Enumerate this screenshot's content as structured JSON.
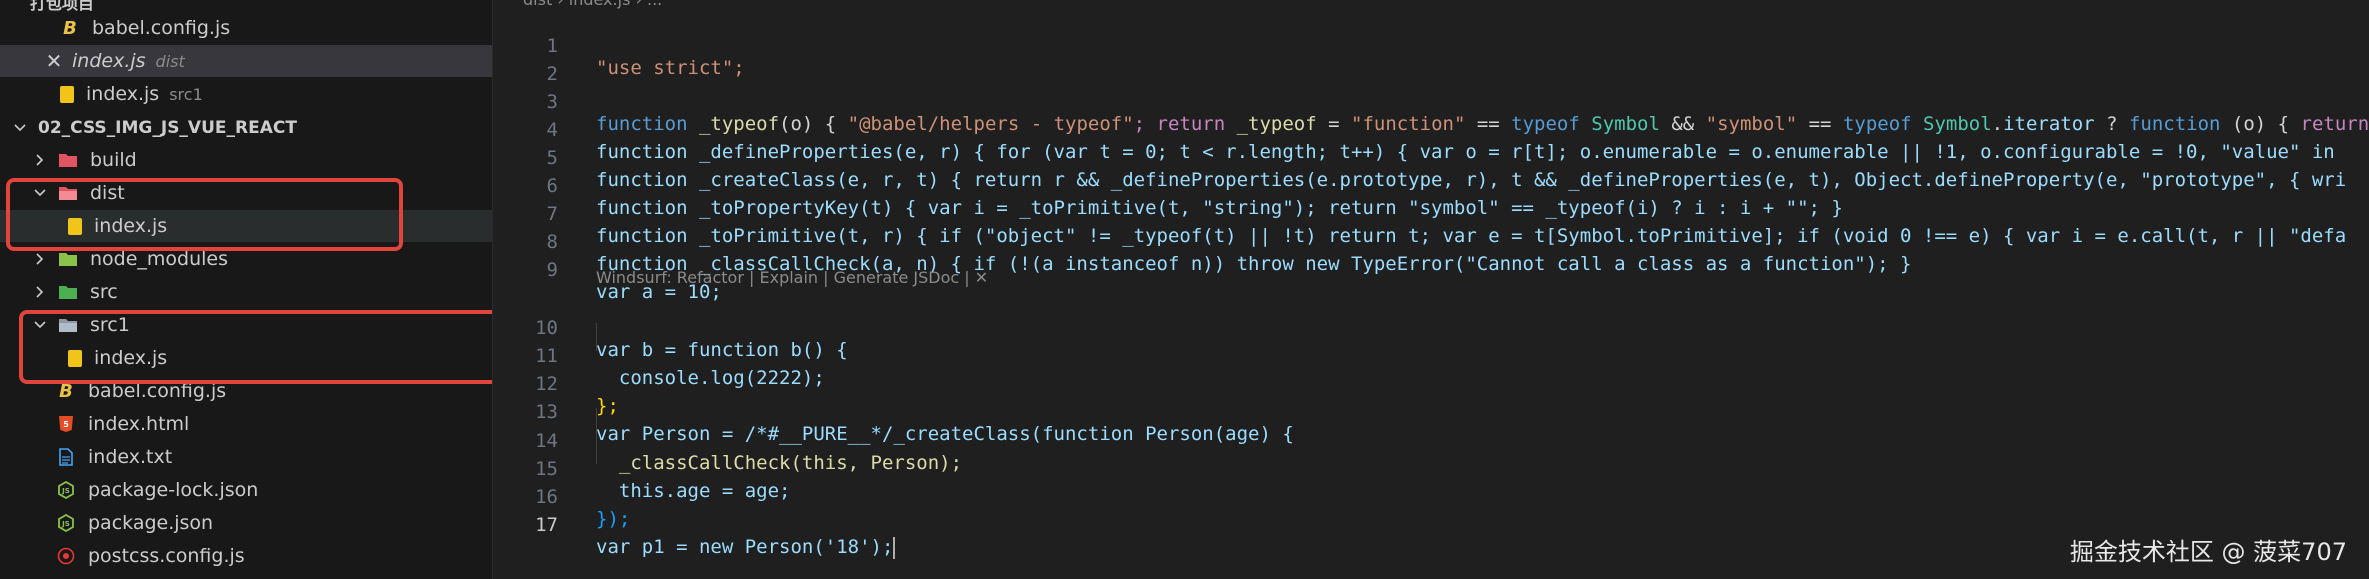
{
  "explorer": {
    "top_folder_partial": "打包项目",
    "items": [
      {
        "label": "babel.config.js",
        "icon": "babel-icon"
      },
      {
        "label": "index.js",
        "desc": "dist",
        "icon": "close-icon"
      },
      {
        "label": "index.js",
        "desc": "src1",
        "icon": "js-file-icon"
      }
    ],
    "section_title": "02_CSS_IMG_JS_VUE_REACT",
    "tree": [
      {
        "label": "build",
        "type": "folder"
      },
      {
        "label": "dist",
        "type": "folder-open"
      },
      {
        "label": "index.js",
        "type": "js"
      },
      {
        "label": "node_modules",
        "type": "folder"
      },
      {
        "label": "src",
        "type": "folder"
      },
      {
        "label": "src1",
        "type": "folder-open"
      },
      {
        "label": "index.js",
        "type": "js"
      },
      {
        "label": "babel.config.js",
        "type": "babel"
      },
      {
        "label": "index.html",
        "type": "html"
      },
      {
        "label": "index.txt",
        "type": "txt"
      },
      {
        "label": "package-lock.json",
        "type": "json"
      },
      {
        "label": "package.json",
        "type": "json"
      },
      {
        "label": "postcss.config.js",
        "type": "postcss"
      }
    ]
  },
  "editor": {
    "breadcrumb": "dist › index.js › ...",
    "codelens": "Windsurf: Refactor | Explain | Generate JSDoc | ✕",
    "line_numbers": [
      "1",
      "2",
      "3",
      "4",
      "5",
      "6",
      "7",
      "8",
      "9",
      "10",
      "11",
      "12",
      "13",
      "14",
      "15",
      "16",
      "17"
    ],
    "active_line": "17",
    "code": {
      "l1": "\"use strict\";",
      "l3a": "function ",
      "l3b": "_typeof",
      "l3c": "(o) { ",
      "l3d": "\"@babel/helpers - typeof\"",
      "l3e": "; return ",
      "l3f": "_typeof",
      "l3g": " = ",
      "l3h": "\"function\"",
      "l3i": " == ",
      "l3j": "typeof ",
      "l3k": "Symbol",
      "l3l": " && ",
      "l3m": "\"symbol\"",
      "l3n": " == ",
      "l3o": "typeof ",
      "l3p": "Symbol",
      "l3q": ".",
      "l3r": "iterator",
      "l3s": " ? ",
      "l3t": "function ",
      "l3u": "(o) { ",
      "l3v": "return",
      "l4": "function _defineProperties(e, r) { for (var t = 0; t < r.length; t++) { var o = r[t]; o.enumerable = o.enumerable || !1, o.configurable = !0, \"value\" in",
      "l5": "function _createClass(e, r, t) { return r && _defineProperties(e.prototype, r), t && _defineProperties(e, t), Object.defineProperty(e, \"prototype\", { wri",
      "l6": "function _toPropertyKey(t) { var i = _toPrimitive(t, \"string\"); return \"symbol\" == _typeof(i) ? i : i + \"\"; }",
      "l7": "function _toPrimitive(t, r) { if (\"object\" != _typeof(t) || !t) return t; var e = t[Symbol.toPrimitive]; if (void 0 !== e) { var i = e.call(t, r || \"defa",
      "l8": "function _classCallCheck(a, n) { if (!(a instanceof n)) throw new TypeError(\"Cannot call a class as a function\"); }",
      "l9": "var a = 10;",
      "l10": "var b = function b() {",
      "l11": "  console.log(2222);",
      "l12": "};",
      "l13": "var Person = /*#__PURE__*/_createClass(function Person(age) {",
      "l14": "  _classCallCheck(this, Person);",
      "l15": "  this.age = age;",
      "l16": "});",
      "l17": "var p1 = new Person('18');"
    }
  },
  "watermark": "掘金技术社区 @ 菠菜707",
  "colors": {
    "highlight_box": "#e0443a",
    "editor_bg": "#1f1f1f",
    "sidebar_bg": "#181818",
    "selected_row": "#37373d"
  }
}
